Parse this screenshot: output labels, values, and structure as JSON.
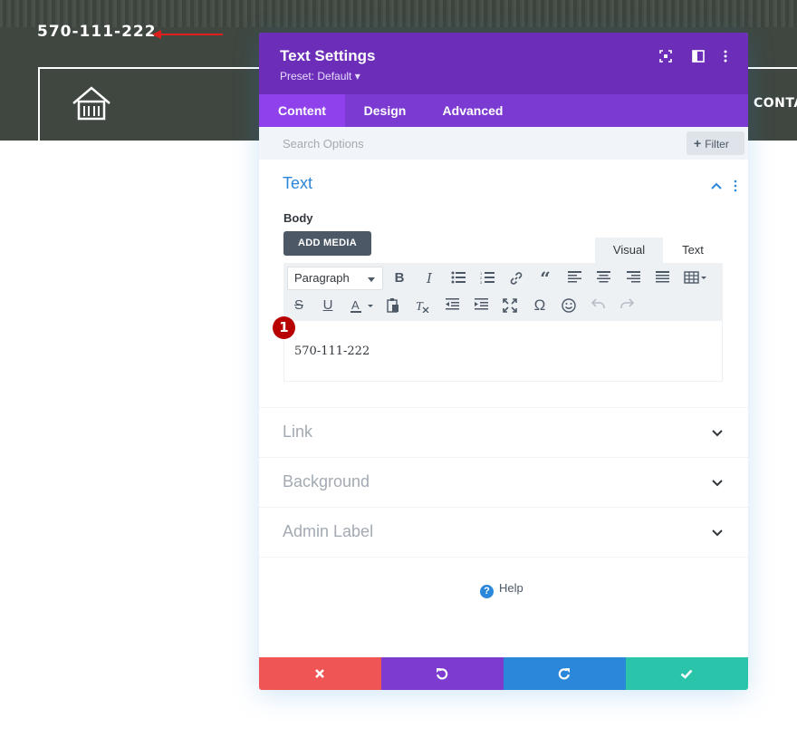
{
  "site": {
    "phone": "570-111-222",
    "nav_contact": "CONTA"
  },
  "modal": {
    "title": "Text Settings",
    "preset": "Preset: Default ▾",
    "tabs": [
      {
        "label": "Content",
        "active": true
      },
      {
        "label": "Design",
        "active": false
      },
      {
        "label": "Advanced",
        "active": false
      }
    ],
    "search_placeholder": "Search Options",
    "filter_label": "Filter",
    "text_section": {
      "title": "Text",
      "body_label": "Body",
      "add_media": "ADD MEDIA",
      "editor_tabs": [
        "Visual",
        "Text"
      ],
      "format_select": "Paragraph",
      "content": "570-111-222"
    },
    "badge": "1",
    "sections": [
      "Link",
      "Background",
      "Admin Label"
    ],
    "help": "Help",
    "colors": {
      "header": "#6c2eb9",
      "tabs": "#7b3ad1",
      "active_tab": "#8f42ec",
      "discard": "#ef5555",
      "undo": "#7e3bd0",
      "redo": "#2b87da",
      "save": "#29c4a9"
    }
  }
}
